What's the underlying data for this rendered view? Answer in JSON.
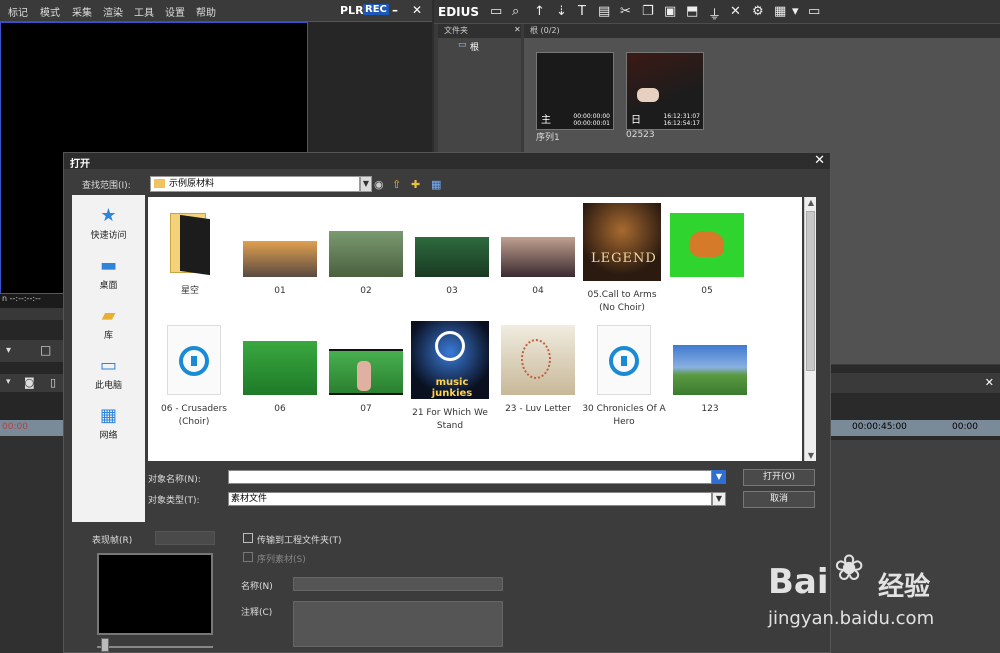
{
  "player": {
    "menu": [
      "标记",
      "模式",
      "采集",
      "渲染",
      "工具",
      "设置",
      "帮助"
    ],
    "plr": "PLR",
    "rec": "REC",
    "timecode": "n --:--:--:--"
  },
  "bin": {
    "app_title": "EDIUS",
    "folder_header": "文件夹",
    "root_label": "根",
    "bin_header": "根 (0/2)",
    "clips": [
      {
        "name": "序列1",
        "tc_in": "00:00:00:00",
        "tc_out": "00:00:00:01",
        "glyph": "主"
      },
      {
        "name": "02523",
        "tc_in": "16:12:31:07",
        "tc_out": "16:12:54:17",
        "glyph": "日"
      }
    ]
  },
  "timeline": {
    "ruler_left": "00:00",
    "ruler_right": "00:00:45:00",
    "ruler_far": "00:00"
  },
  "dialog": {
    "title": "打开",
    "lookin_label": "查找范围(I):",
    "lookin_value": "示例原材料",
    "places": [
      "快速访问",
      "桌面",
      "库",
      "此电脑",
      "网络"
    ],
    "items": [
      {
        "name": "星空",
        "kind": "folder"
      },
      {
        "name": "01",
        "kind": "image",
        "colors": [
          "#e0a050",
          "#5a4a40"
        ]
      },
      {
        "name": "02",
        "kind": "image",
        "colors": [
          "#7a9a70",
          "#4a6040"
        ]
      },
      {
        "name": "03",
        "kind": "image",
        "colors": [
          "#2e6a3e",
          "#1a3a22"
        ]
      },
      {
        "name": "04",
        "kind": "image",
        "colors": [
          "#c0a090",
          "#3a2a30"
        ]
      },
      {
        "name": "05.Call to Arms (No Choir)",
        "kind": "legend",
        "legend_text": "LEGEND"
      },
      {
        "name": "05",
        "kind": "tiger"
      },
      {
        "name": "06 - Crusaders (Choir)",
        "kind": "audio"
      },
      {
        "name": "06",
        "kind": "image",
        "colors": [
          "#3aa840",
          "#1e7a28"
        ]
      },
      {
        "name": "07",
        "kind": "image",
        "colors": [
          "#48b050",
          "#2a8030"
        ]
      },
      {
        "name": "21 For Which We Stand",
        "kind": "music",
        "brand": "music junkies"
      },
      {
        "name": "23 - Luv Letter",
        "kind": "image",
        "colors": [
          "#f0ece0",
          "#c8b898"
        ]
      },
      {
        "name": "30 Chronicles Of A Hero",
        "kind": "audio"
      },
      {
        "name": "123",
        "kind": "image",
        "colors": [
          "#3f7ad0",
          "#5a9a40"
        ]
      }
    ],
    "name_label": "对象名称(N):",
    "name_value": "",
    "type_label": "对象类型(T):",
    "type_value": "素材文件",
    "open_button": "打开(O)",
    "cancel_button": "取消",
    "preview_label": "表现帧(R)",
    "transfer_label": "传输到工程文件夹(T)",
    "sequence_label": "序列素材(S)",
    "clip_name_label": "名称(N)",
    "comment_label": "注释(C)"
  },
  "watermark": {
    "brand": "Bai",
    "cn": "经验",
    "url": "jingyan.baidu.com"
  }
}
